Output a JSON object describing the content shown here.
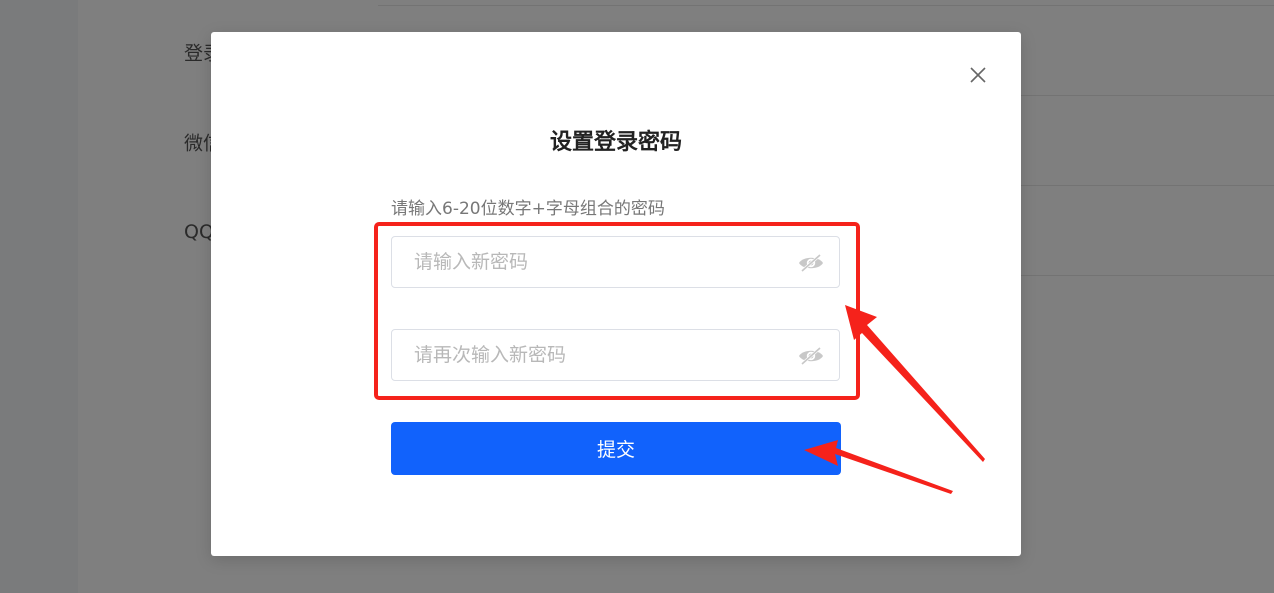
{
  "background": {
    "rows": [
      {
        "label": "登录"
      },
      {
        "label": "微信"
      },
      {
        "label": "QQ"
      }
    ]
  },
  "dialog": {
    "title": "设置登录密码",
    "hint": "请输入6-20位数字+字母组合的密码",
    "new_password": {
      "value": "",
      "placeholder": "请输入新密码"
    },
    "confirm_password": {
      "value": "",
      "placeholder": "请再次输入新密码"
    },
    "submit_label": "提交",
    "close_icon": "close-icon",
    "visibility_icon": "eye-hidden-icon"
  },
  "colors": {
    "primary": "#1162fc",
    "annotation": "#f5221b",
    "overlay": "rgba(0,0,0,0.5)"
  }
}
